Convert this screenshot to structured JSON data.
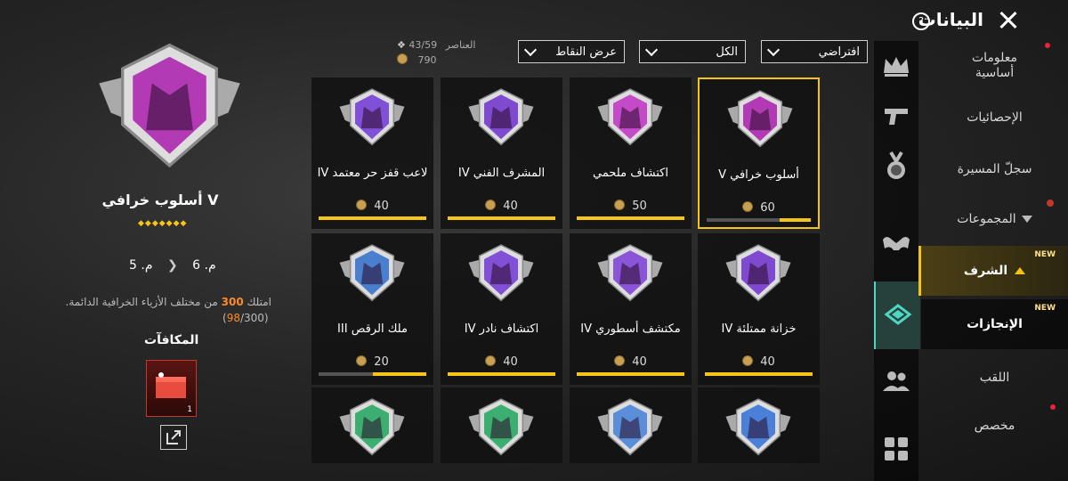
{
  "header": {
    "title": "البيانات",
    "help_icon": "question-icon",
    "close_icon": "close-icon"
  },
  "sidebar": {
    "items": [
      {
        "label": "معلومات أساسية",
        "icon": "crown-icon"
      },
      {
        "label": "الإحصائيات",
        "icon": "pistol-icon"
      },
      {
        "label": "سجلّ المسيرة",
        "icon": "medal-icon"
      },
      {
        "label": "المجموعات",
        "icon": "muscle-icon"
      },
      {
        "label": "الشرف",
        "icon": "honor-icon",
        "new": "NEW",
        "active": true
      },
      {
        "label": "الإنجازات",
        "icon": "achievements-icon",
        "new": "NEW",
        "active": true
      },
      {
        "label": "اللقب",
        "icon": "friends-icon"
      },
      {
        "label": "مخصص",
        "icon": "grid-icon"
      }
    ]
  },
  "filters": {
    "sort": "افتراضي",
    "category": "الكل",
    "view": "عرض النقاط"
  },
  "stats": {
    "items_label": "العناصر",
    "items_value": "43/59",
    "points_value": "790"
  },
  "cards": [
    {
      "name": "أسلوب خرافي V",
      "points": "60",
      "progress": 0.3,
      "color": "#b23bb5",
      "selected": true
    },
    {
      "name": "اكتشاف ملحمي",
      "points": "50",
      "progress": 1,
      "color": "#c44ac8"
    },
    {
      "name": "المشرف الفني IV",
      "points": "40",
      "progress": 1,
      "color": "#7f4ad0"
    },
    {
      "name": "لاعب قفز حر معتمد IV",
      "points": "40",
      "progress": 1,
      "color": "#8050d6"
    },
    {
      "name": "خزانة ممتلئة IV",
      "points": "40",
      "progress": 1,
      "color": "#7f4ad0"
    },
    {
      "name": "مكتشف أسطوري IV",
      "points": "40",
      "progress": 1,
      "color": "#8a55d8"
    },
    {
      "name": "اكتشاف نادر IV",
      "points": "40",
      "progress": 1,
      "color": "#8050d6"
    },
    {
      "name": "ملك الرقص III",
      "points": "20",
      "progress": 0.5,
      "color": "#4a7fd0"
    },
    {
      "name": "",
      "points": "",
      "progress": 0,
      "color": "#4a80d8"
    },
    {
      "name": "",
      "points": "",
      "progress": 0,
      "color": "#5a8ed8"
    },
    {
      "name": "",
      "points": "",
      "progress": 0,
      "color": "#3cae70"
    },
    {
      "name": "",
      "points": "",
      "progress": 0,
      "color": "#3cae70"
    }
  ],
  "detail": {
    "name": "أسلوب خرافي V",
    "level_current": "م. 6",
    "level_next": "م. 5",
    "description_prefix": "امتلك",
    "description_count": "300",
    "description_suffix": "من مختلف الأزياء الخرافية الدائمة.",
    "progress_current": "98",
    "progress_total": "/300",
    "rewards_title": "المكافآت",
    "reward_count": "1",
    "color": "#b23bb5"
  }
}
